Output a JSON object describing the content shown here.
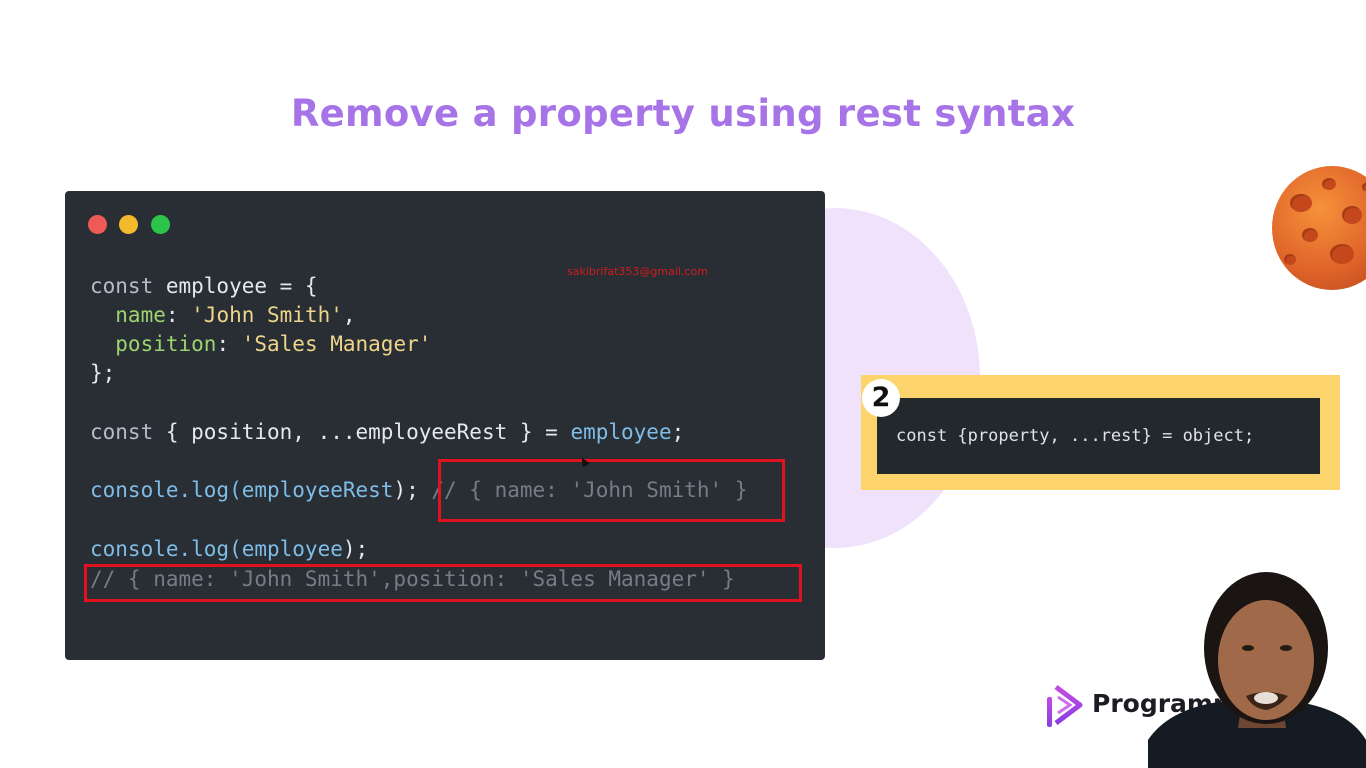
{
  "slide": {
    "title": "Remove a property using rest syntax"
  },
  "watermark": "sakibrifat353@gmail.com",
  "code_lines": {
    "l1": {
      "kw": "const",
      "rest": " employee = {"
    },
    "l2": {
      "prop": "  name",
      "colon": ": ",
      "str": "'John Smith'",
      "end": ","
    },
    "l3": {
      "prop": "  position",
      "colon": ": ",
      "str": "'Sales Manager'"
    },
    "l4": "};",
    "l5": {
      "kw": "const",
      "mid": " { position, ...employeeRest } = ",
      "var": "employee",
      "end": ";"
    },
    "l6": {
      "fn": "console.log(",
      "var": "employeeRest",
      "end": ");",
      "comment": " // { name: 'John Smith' }"
    },
    "l7": {
      "fn": "console.log(",
      "var": "employee",
      "end": ");"
    },
    "l8": "// { name: 'John Smith',position: 'Sales Manager' }"
  },
  "syntax_card": {
    "badge": "2",
    "code": "const {property, ...rest} = object;"
  },
  "brand": {
    "name": "Programmin"
  },
  "colors": {
    "title": "#a774e8",
    "code_bg": "#282e33",
    "highlight_box": "#e0121e",
    "yellow_panel": "#fdd46b"
  },
  "icons": {
    "window_controls": [
      "close-dot",
      "minimize-dot",
      "maximize-dot"
    ],
    "decoration": "planet-icon",
    "logo": "programming-logo-icon"
  }
}
